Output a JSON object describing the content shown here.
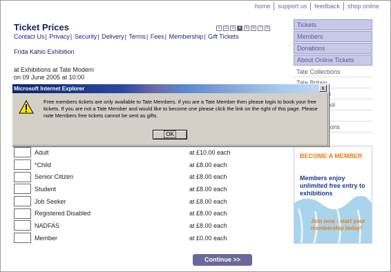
{
  "top_nav": [
    "home",
    "support us",
    "feedback",
    "shop online"
  ],
  "page_title": "Ticket Prices",
  "pager": [
    "1",
    "2",
    "3",
    "4",
    "5",
    "6",
    "7",
    "8"
  ],
  "sub_nav": [
    "Contact Us",
    "Privacy",
    "Security",
    "Delivery",
    "Terms",
    "Fees",
    "Membership",
    "Gift Tickets"
  ],
  "exhibition": "Frida Kahlo Exhibition",
  "venue_line1": "at Exhibitions at Tate Modern",
  "venue_line2": "on 09 June 2005 at 10:00",
  "sidebar": {
    "boxed": [
      "Tickets",
      "Members",
      "Donations",
      "About Online Tickets"
    ],
    "plain": [
      "Tate Collections",
      "Tate Britain",
      "Tate Modern",
      "Tate Liverpool",
      "Tate St Ives",
      "Tate Exhibitions"
    ]
  },
  "dialog": {
    "title": "Microsoft Internet Explorer",
    "close": "x",
    "message": "Free members tickets are only available to Tate Members.  If you are a Tate Member then please login to book your free tickets.  If you are not a Tate Member and would like to become one please click the link on the right of this page.  Please note Members free tickets cannot be sent as gifts.",
    "ok_label": "OK",
    "icon": "warning-icon"
  },
  "tickets": [
    {
      "name": "Adult",
      "price": "at £10.00 each"
    },
    {
      "name": "*Child",
      "price": "at £8.00 each"
    },
    {
      "name": "Senior Citizen",
      "price": "at £8.00 each"
    },
    {
      "name": "Student",
      "price": "at £8.00 each"
    },
    {
      "name": "Job Seeker",
      "price": "at £8.00 each"
    },
    {
      "name": "Registered Disabled",
      "price": "at £8.00 each"
    },
    {
      "name": "NADFAS",
      "price": "at £8.00 each"
    },
    {
      "name": "Member",
      "price": "at £0.00 each"
    }
  ],
  "banner": {
    "headline": "BECOME A MEMBER",
    "body": "Members enjoy unlimited free entry to exhibitions",
    "cta": "Join now - start your membership today!"
  },
  "continue_label": "Continue >>",
  "colors": {
    "accent": "#6a6a9a",
    "title": "#1a1a6e",
    "banner_orange": "#f07a10"
  }
}
